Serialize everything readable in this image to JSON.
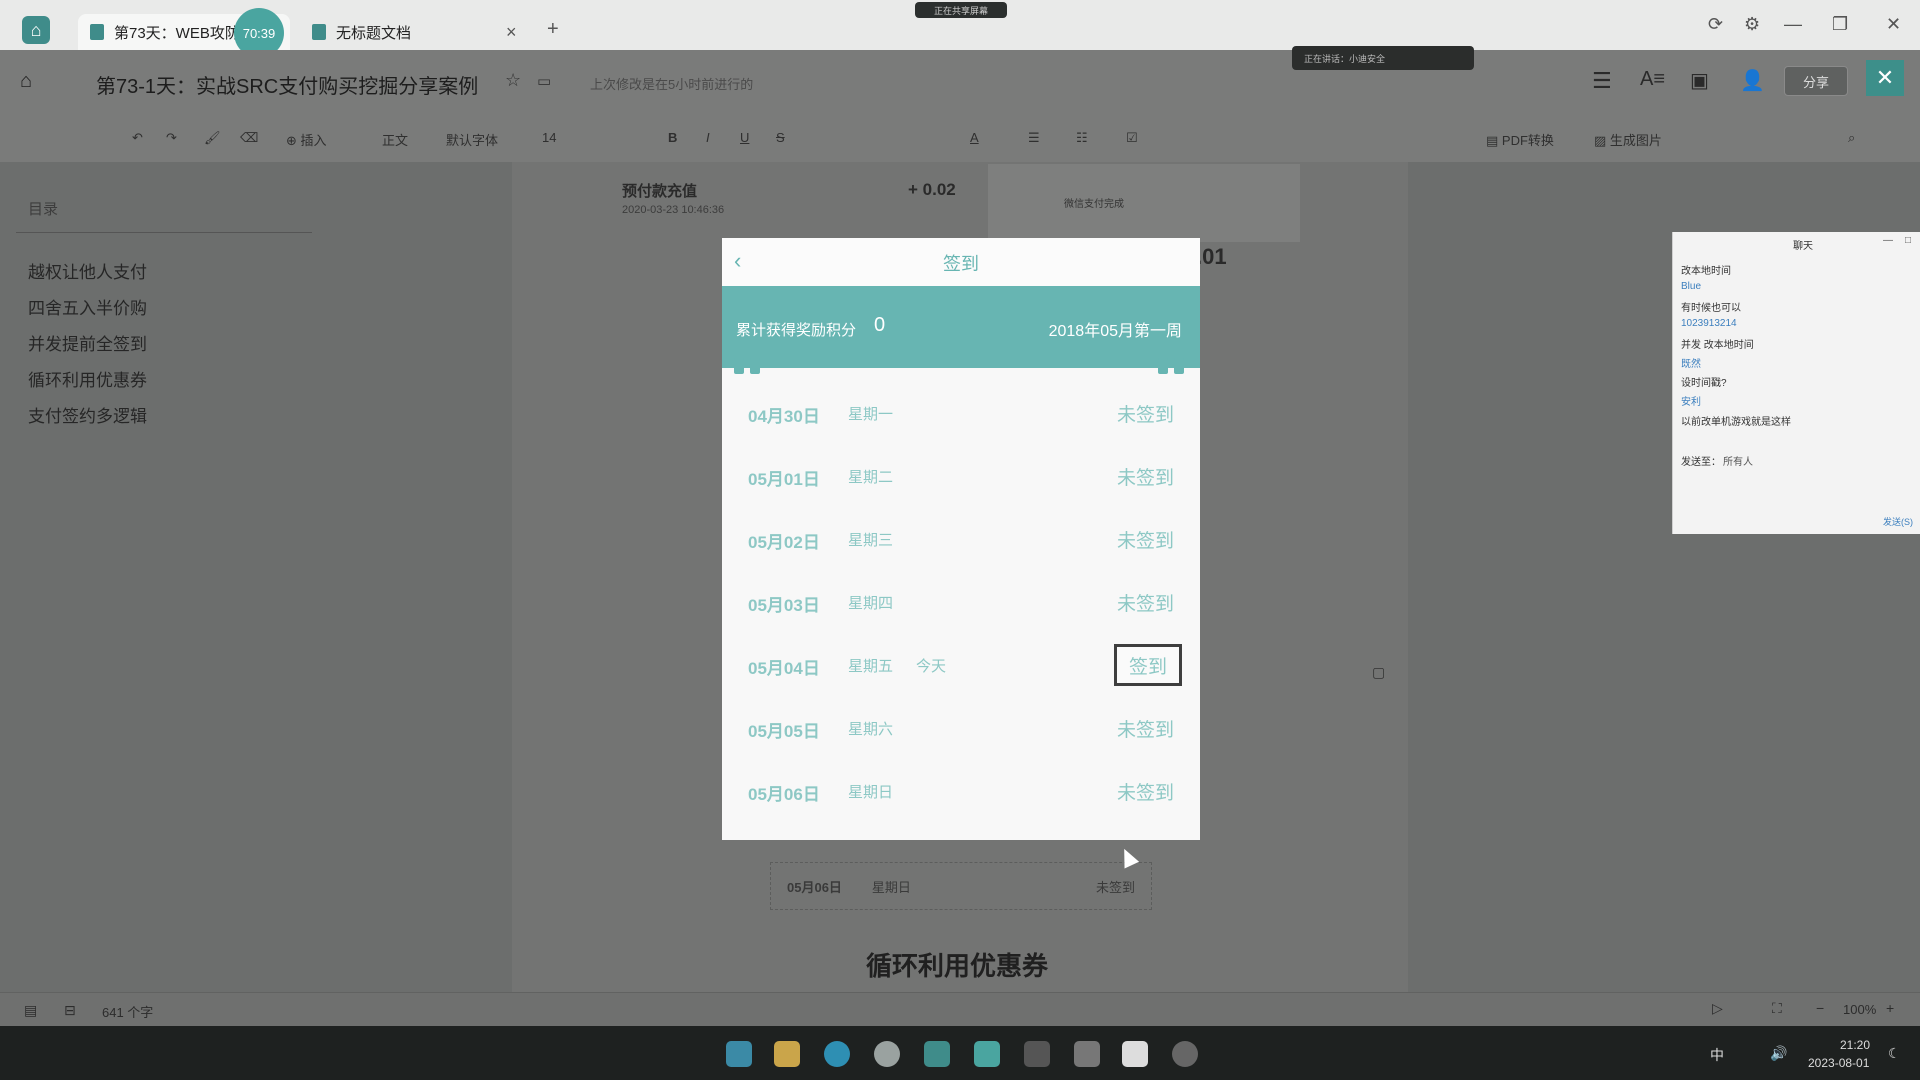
{
  "tabs": [
    {
      "label": "第73天：WEB攻防-3",
      "close": ""
    },
    {
      "label": "无标题文档",
      "close": "×"
    }
  ],
  "timer_badge": "70:39",
  "share_indicator": "正在共享屏幕",
  "add_tab": "+",
  "window_controls": {
    "minimize": "—",
    "restore": "❐",
    "close": "✕"
  },
  "document": {
    "title": "第73-1天：实战SRC支付购买挖掘分享案例",
    "save_status": "上次修改是在5小时前进行的"
  },
  "toolbar": {
    "insert": "插入",
    "style": "正文",
    "font": "默认字体",
    "size": "14",
    "pdf": "PDF转换",
    "image": "生成图片"
  },
  "speaking": "正在讲话：小迪安全",
  "share_button": "分享",
  "close_overlay": "✕",
  "outline": {
    "title": "目录",
    "items": [
      "越权让他人支付",
      "四舍五入半价购",
      "并发提前全签到",
      "循环利用优惠券",
      "支付签约多逻辑"
    ]
  },
  "background_doc": {
    "prepay_label": "预付款充值",
    "prepay_date": "2020-03-23 10:46:36",
    "prepay_amount": "+ 0.02",
    "card_title": "微信支付完成",
    "number": ".01",
    "row_date": "05月06日",
    "row_weekday": "星期日",
    "row_status": "未签到",
    "section_heading": "循环利用优惠券"
  },
  "modal": {
    "back": "‹",
    "title": "签到",
    "points_label": "累计获得奖励积分",
    "points_value": "0",
    "week_label": "2018年05月第一周",
    "rows": [
      {
        "date": "04月30日",
        "weekday": "星期一",
        "today": "",
        "status": "未签到"
      },
      {
        "date": "05月01日",
        "weekday": "星期二",
        "today": "",
        "status": "未签到"
      },
      {
        "date": "05月02日",
        "weekday": "星期三",
        "today": "",
        "status": "未签到"
      },
      {
        "date": "05月03日",
        "weekday": "星期四",
        "today": "",
        "status": "未签到"
      },
      {
        "date": "05月04日",
        "weekday": "星期五",
        "today": "今天",
        "status": "签到"
      },
      {
        "date": "05月05日",
        "weekday": "星期六",
        "today": "",
        "status": "未签到"
      },
      {
        "date": "05月06日",
        "weekday": "星期日",
        "today": "",
        "status": "未签到"
      }
    ]
  },
  "chat": {
    "title": "聊天",
    "lines": [
      {
        "text": "改本地时间",
        "kind": "msg"
      },
      {
        "text": "Blue",
        "kind": "name"
      },
      {
        "text": "有时候也可以",
        "kind": "msg"
      },
      {
        "text": "1023913214",
        "kind": "name"
      },
      {
        "text": "并发 改本地时间",
        "kind": "msg"
      },
      {
        "text": "既然",
        "kind": "name"
      },
      {
        "text": "设时间戳?",
        "kind": "msg"
      },
      {
        "text": "安利",
        "kind": "name"
      },
      {
        "text": "以前改单机游戏就是这样",
        "kind": "msg"
      }
    ],
    "send_to_label": "发送至：",
    "recipient": "所有人",
    "send_button": "发送(S)"
  },
  "status_bar": {
    "word_count": "641 个字",
    "zoom": "100%"
  },
  "taskbar": {
    "ime": "中",
    "time": "21:20",
    "date": "2023-08-01"
  },
  "colors": {
    "accent": "#67b5b2",
    "accent_light": "#8dc8c5",
    "tab_icon": "#3f8c8a"
  }
}
